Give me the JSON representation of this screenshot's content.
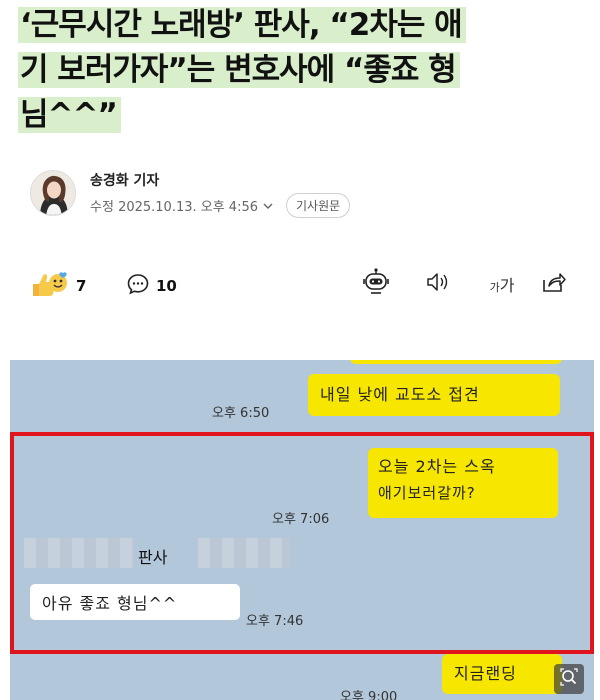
{
  "article": {
    "headline_lines": [
      "‘근무시간 노래방’ 판사, “2차는 애",
      "기 보러가자”는 변호사에 “좋죠 형",
      "님^^”"
    ],
    "author": "송경화 기자",
    "modified_label": "수정",
    "datetime": "2025.10.13. 오후 4:56",
    "original_button": "기사원문"
  },
  "actions": {
    "reaction_count": "7",
    "comment_count": "10",
    "font_label_small": "가",
    "font_label_large": "가"
  },
  "chat": {
    "msg1": "내일 낮에 교도소 접견",
    "time1": "오후 6:50",
    "msg2_line1": "오늘 2차는 스옥",
    "msg2_line2": "애기보러갈까?",
    "time2": "오후 7:06",
    "sender_label": "판사",
    "reply": "아유 좋죠 형님^^",
    "time3": "오후 7:46",
    "msg4": "지금랜딩",
    "time4": "오후 9:00"
  },
  "colors": {
    "highlight": "#d9efcc",
    "kakao_yellow": "#f7e600",
    "chat_bg": "#b2c7da",
    "red_frame": "#e0141c"
  },
  "icons": [
    "avatar",
    "chevron-down-icon",
    "reaction-emoji-icon",
    "comment-icon",
    "robot-icon",
    "speaker-icon",
    "font-size-icon",
    "share-icon",
    "zoom-icon"
  ]
}
